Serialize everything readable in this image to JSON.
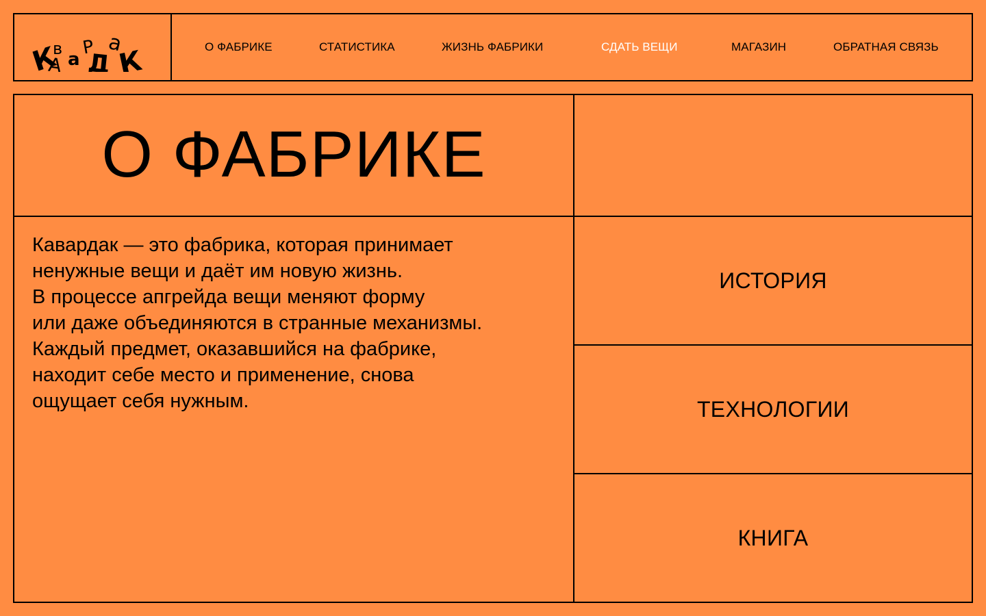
{
  "header": {
    "logo_text": "КАВАРДАК",
    "nav": [
      {
        "label": "О ФАБРИКЕ",
        "active": false
      },
      {
        "label": "СТАТИСТИКА",
        "active": false
      },
      {
        "label": "ЖИЗНЬ ФАБРИКИ",
        "active": false
      },
      {
        "label": "СДАТЬ ВЕЩИ",
        "active": true
      },
      {
        "label": "МАГАЗИН",
        "active": false
      },
      {
        "label": "ОБРАТНАЯ СВЯЗЬ",
        "active": false
      }
    ]
  },
  "main": {
    "title": "О ФАБРИКЕ",
    "description_lines": [
      "Кавардак — это фабрика, которая принимает",
      "ненужные вещи и даёт им новую жизнь.",
      "В процессе апгрейда вещи меняют форму",
      "или даже объединяются в странные механизмы.",
      "Каждый предмет, оказавшийся на фабрике,",
      "находит себе место и применение, снова",
      "ощущает себя нужным."
    ],
    "side_links": [
      {
        "label": "ИСТОРИЯ"
      },
      {
        "label": "ТЕХНОЛОГИИ"
      },
      {
        "label": "КНИГА"
      }
    ]
  },
  "colors": {
    "background": "#FF8C42",
    "text": "#000000",
    "active_nav": "#FFFFFF"
  }
}
